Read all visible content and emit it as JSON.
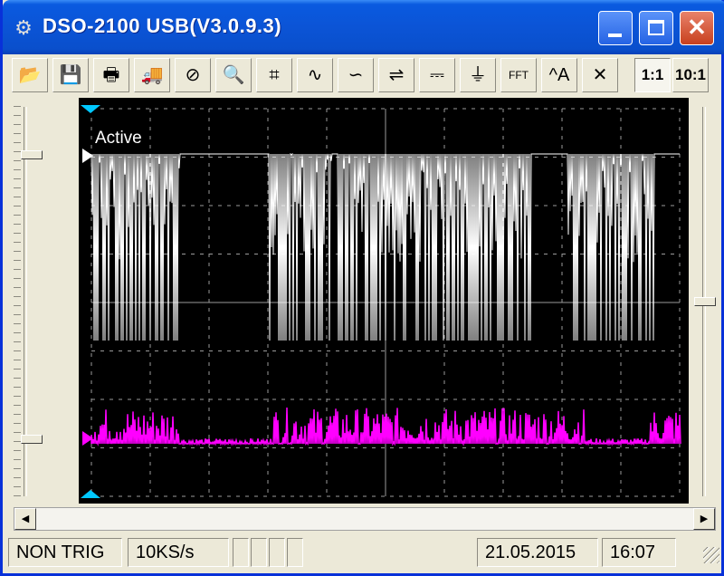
{
  "window": {
    "title": "DSO-2100 USB(V3.0.9.3)"
  },
  "toolbar": {
    "buttons": [
      {
        "name": "open-icon",
        "glyph": "📂"
      },
      {
        "name": "save-icon",
        "glyph": "💾"
      },
      {
        "name": "print-icon",
        "glyph": "🖶"
      },
      {
        "name": "truck-icon",
        "glyph": "🚚"
      },
      {
        "name": "stop-icon",
        "glyph": "⊘"
      },
      {
        "name": "zoom-icon",
        "glyph": "🔍"
      },
      {
        "name": "grid-icon",
        "glyph": "⌗"
      },
      {
        "name": "rising-edge-icon",
        "glyph": "∿"
      },
      {
        "name": "falling-edge-icon",
        "glyph": "∽"
      },
      {
        "name": "trigger-level-icon",
        "glyph": "⇌"
      },
      {
        "name": "dc-coupling-icon",
        "glyph": "⎓"
      },
      {
        "name": "ground-icon",
        "glyph": "⏚"
      },
      {
        "name": "fft-icon",
        "glyph": "FFT"
      },
      {
        "name": "measure-icon",
        "glyph": "^A"
      },
      {
        "name": "cursor-icon",
        "glyph": "✕"
      }
    ],
    "ratio_1_1": "1:1",
    "ratio_10_1": "10:1"
  },
  "scope": {
    "trace_label": "Active",
    "colors": {
      "ch1": "#ffffff",
      "ch2": "#ff00ff",
      "grid": "#9a9a9a",
      "marker": "#00c8ff"
    }
  },
  "status": {
    "trigger": "NON TRIG",
    "sample_rate": "10KS/s",
    "date": "21.05.2015",
    "time": "16:07"
  }
}
